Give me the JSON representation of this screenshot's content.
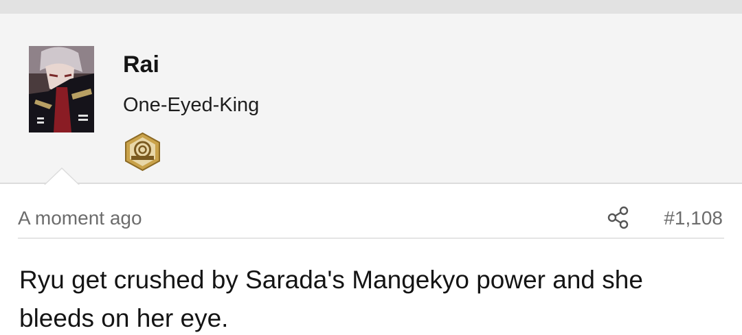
{
  "user": {
    "name": "Rai",
    "title": "One-Eyed-King",
    "badge_icon": "fanverse-badge-icon",
    "avatar_icon": "avatar-image"
  },
  "post": {
    "timestamp": "A moment ago",
    "number": "#1,108",
    "share_icon": "share-icon",
    "body": "Ryu get crushed by Sarada's Mangekyo power and she bleeds on her eye."
  },
  "colors": {
    "header_bg": "#f4f4f4",
    "meta_text": "#6c6c6c",
    "body_text": "#141414",
    "badge_gold": "#c9a24a"
  }
}
